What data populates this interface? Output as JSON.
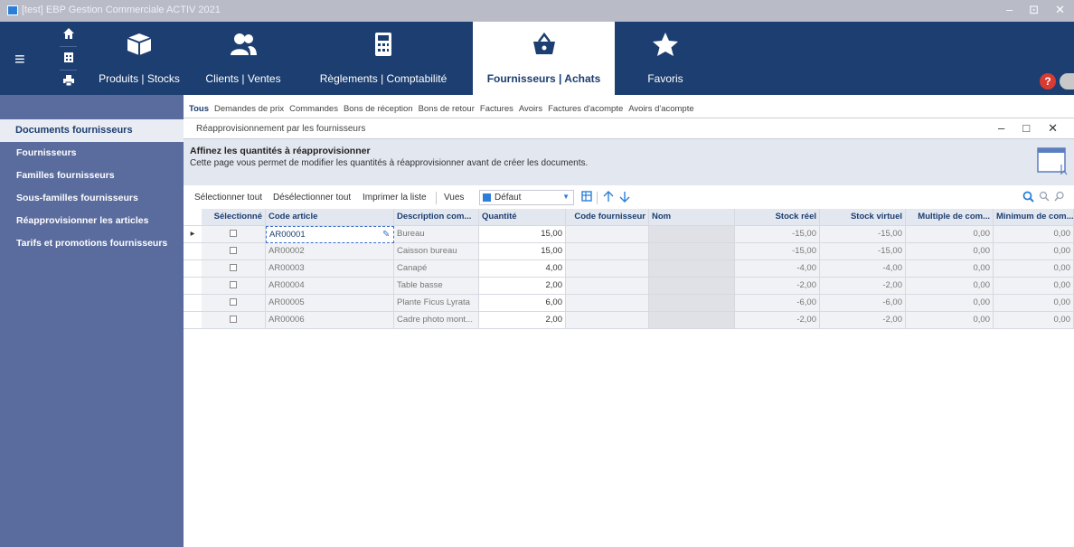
{
  "window": {
    "title": "[test] EBP Gestion Commerciale ACTIV 2021",
    "controls": [
      "–",
      "⊡",
      "✕"
    ]
  },
  "ribbon": {
    "modules": [
      {
        "label": "Produits | Stocks",
        "icon": "box-icon"
      },
      {
        "label": "Clients | Ventes",
        "icon": "users-icon"
      },
      {
        "label": "Règlements | Comptabilité",
        "icon": "calculator-icon"
      },
      {
        "label": "Fournisseurs | Achats",
        "icon": "basket-icon",
        "active": true
      },
      {
        "label": "Favoris",
        "icon": "star-icon"
      }
    ],
    "help_label": "?"
  },
  "sidebar": {
    "items": [
      {
        "label": "Documents fournisseurs",
        "active": true
      },
      {
        "label": "Fournisseurs"
      },
      {
        "label": "Familles fournisseurs"
      },
      {
        "label": "Sous-familles fournisseurs"
      },
      {
        "label": "Réapprovisionner les articles"
      },
      {
        "label": "Tarifs et promotions fournisseurs"
      }
    ]
  },
  "tabs": [
    {
      "label": "Tous",
      "active": true
    },
    {
      "label": "Demandes de prix"
    },
    {
      "label": "Commandes"
    },
    {
      "label": "Bons de réception"
    },
    {
      "label": "Bons de retour"
    },
    {
      "label": "Factures"
    },
    {
      "label": "Avoirs"
    },
    {
      "label": "Factures d'acompte"
    },
    {
      "label": "Avoirs d'acompte"
    }
  ],
  "panel": {
    "title": "Réapprovisionnement par les fournisseurs",
    "controls": [
      "–",
      "□",
      "✕"
    ]
  },
  "info": {
    "title": "Affinez les quantités à réapprovisionner",
    "description": "Cette page vous permet de modifier les quantités à réapprovisionner avant de créer les documents."
  },
  "toolbar": {
    "select_all": "Sélectionner tout",
    "deselect_all": "Désélectionner tout",
    "print_list": "Imprimer la liste",
    "views_label": "Vues",
    "view_value": "Défaut"
  },
  "grid": {
    "columns": [
      "Sélectionné",
      "Code article",
      "Description com...",
      "Quantité",
      "Code fournisseur",
      "Nom",
      "Stock réel",
      "Stock virtuel",
      "Multiple de com...",
      "Minimum de com..."
    ],
    "rows": [
      {
        "code": "AR00001",
        "description": "Bureau",
        "quantite": "15,00",
        "stock_reel": "-15,00",
        "stock_virtuel": "-15,00",
        "multiple": "0,00",
        "minimum": "0,00"
      },
      {
        "code": "AR00002",
        "description": "Caisson bureau",
        "quantite": "15,00",
        "stock_reel": "-15,00",
        "stock_virtuel": "-15,00",
        "multiple": "0,00",
        "minimum": "0,00"
      },
      {
        "code": "AR00003",
        "description": "Canapé",
        "quantite": "4,00",
        "stock_reel": "-4,00",
        "stock_virtuel": "-4,00",
        "multiple": "0,00",
        "minimum": "0,00"
      },
      {
        "code": "AR00004",
        "description": "Table basse",
        "quantite": "2,00",
        "stock_reel": "-2,00",
        "stock_virtuel": "-2,00",
        "multiple": "0,00",
        "minimum": "0,00"
      },
      {
        "code": "AR00005",
        "description": "Plante Ficus Lyrata",
        "quantite": "6,00",
        "stock_reel": "-6,00",
        "stock_virtuel": "-6,00",
        "multiple": "0,00",
        "minimum": "0,00"
      },
      {
        "code": "AR00006",
        "description": "Cadre photo mont...",
        "quantite": "2,00",
        "stock_reel": "-2,00",
        "stock_virtuel": "-2,00",
        "multiple": "0,00",
        "minimum": "0,00"
      }
    ]
  },
  "colors": {
    "ribbon": "#1c3e70",
    "sidebar": "#5a6b9e",
    "accent": "#2c7fd8",
    "info_band": "#e3e7ef"
  }
}
